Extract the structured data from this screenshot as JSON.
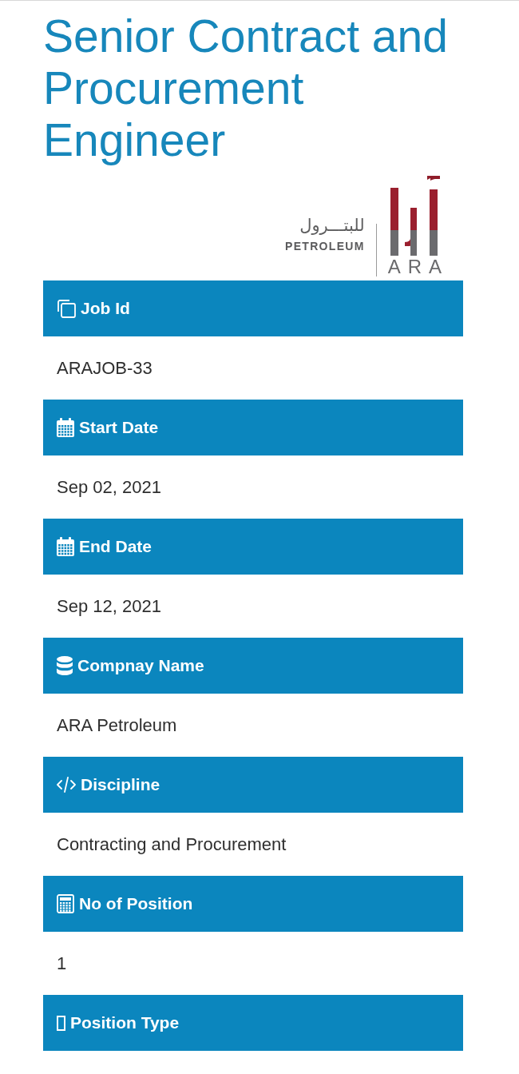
{
  "title": "Senior Contract and Procurement Engineer",
  "logo": {
    "arabic": "للبتـــرول",
    "wordmark": "PETROLEUM",
    "initials": "ARA"
  },
  "sections": [
    {
      "kind": "copy",
      "label": "Job Id",
      "value": "ARAJOB-33"
    },
    {
      "kind": "calendar",
      "label": "Start Date",
      "value": "Sep 02, 2021"
    },
    {
      "kind": "calendar",
      "label": "End Date",
      "value": "Sep 12, 2021"
    },
    {
      "kind": "database",
      "label": "Compnay Name",
      "value": "ARA Petroleum"
    },
    {
      "kind": "code",
      "label": "Discipline",
      "value": "Contracting and Procurement"
    },
    {
      "kind": "calculator",
      "label": "No of Position",
      "value": "1"
    },
    {
      "kind": "blank",
      "label": "Position Type"
    }
  ]
}
